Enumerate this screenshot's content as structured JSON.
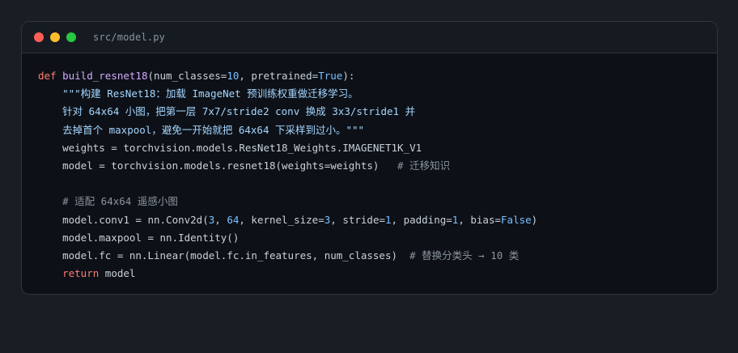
{
  "window": {
    "filename": "src/model.py",
    "controls": {
      "close_color": "#ff5f56",
      "minimize_color": "#ffbd2e",
      "maximize_color": "#27c93f"
    }
  },
  "code": {
    "language": "python",
    "lines": [
      {
        "tokens": [
          {
            "t": "def",
            "c": "kw"
          },
          {
            "t": " "
          },
          {
            "t": "build_resnet18",
            "c": "fn"
          },
          {
            "t": "(num_classes="
          },
          {
            "t": "10",
            "c": "num"
          },
          {
            "t": ", pretrained="
          },
          {
            "t": "True",
            "c": "cst"
          },
          {
            "t": "):"
          }
        ]
      },
      {
        "tokens": [
          {
            "t": "    "
          },
          {
            "t": "\"\"\"构建 ResNet18：加载 ImageNet 预训练权重做迁移学习。",
            "c": "str"
          }
        ]
      },
      {
        "tokens": [
          {
            "t": "    "
          },
          {
            "t": "针对 64x64 小图，把第一层 7x7/stride2 conv 换成 3x3/stride1 并",
            "c": "str"
          }
        ]
      },
      {
        "tokens": [
          {
            "t": "    "
          },
          {
            "t": "去掉首个 maxpool，避免一开始就把 64x64 下采样到过小。\"\"\"",
            "c": "str"
          }
        ]
      },
      {
        "tokens": [
          {
            "t": "    weights = torchvision.models.ResNet18_Weights.IMAGENET1K_V1"
          }
        ]
      },
      {
        "tokens": [
          {
            "t": "    model = torchvision.models.resnet18(weights=weights)   "
          },
          {
            "t": "# 迁移知识",
            "c": "cm"
          }
        ]
      },
      {
        "tokens": []
      },
      {
        "tokens": [
          {
            "t": "    "
          },
          {
            "t": "# 适配 64x64 遥感小图",
            "c": "cm"
          }
        ]
      },
      {
        "tokens": [
          {
            "t": "    model.conv1 = nn.Conv2d("
          },
          {
            "t": "3",
            "c": "num"
          },
          {
            "t": ", "
          },
          {
            "t": "64",
            "c": "num"
          },
          {
            "t": ", kernel_size="
          },
          {
            "t": "3",
            "c": "num"
          },
          {
            "t": ", stride="
          },
          {
            "t": "1",
            "c": "num"
          },
          {
            "t": ", padding="
          },
          {
            "t": "1",
            "c": "num"
          },
          {
            "t": ", bias="
          },
          {
            "t": "False",
            "c": "cst"
          },
          {
            "t": ")"
          }
        ]
      },
      {
        "tokens": [
          {
            "t": "    model.maxpool = nn.Identity()"
          }
        ]
      },
      {
        "tokens": [
          {
            "t": "    model.fc = nn.Linear(model.fc.in_features, num_classes)  "
          },
          {
            "t": "# 替换分类头 → 10 类",
            "c": "cm"
          }
        ]
      },
      {
        "tokens": [
          {
            "t": "    "
          },
          {
            "t": "return",
            "c": "kw"
          },
          {
            "t": " model"
          }
        ]
      }
    ]
  }
}
